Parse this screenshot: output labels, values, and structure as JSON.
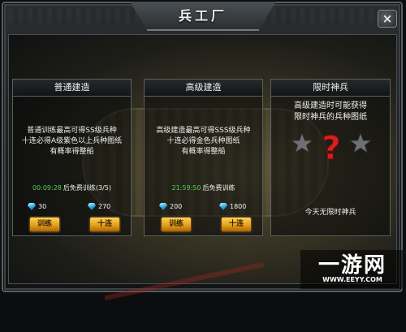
{
  "window": {
    "title": "兵工厂",
    "close_label": "×"
  },
  "panels": [
    {
      "header": "普通建造",
      "description": [
        "普通训练最高可得SS级兵种",
        "十连必得A级紫色以上兵种图纸",
        "有概率得整船"
      ],
      "timer": "00:09:28",
      "timer_text": "后免费训练(3/5)",
      "cost_single": "30",
      "cost_ten": "270",
      "btn_single": "训练",
      "btn_ten": "十连"
    },
    {
      "header": "高级建造",
      "description": [
        "高级建造最高可得SSS级兵种",
        "十连必得金色兵种图纸",
        "有概率得整船"
      ],
      "timer": "21:59:50",
      "timer_text": "后免费训练",
      "cost_single": "200",
      "cost_ten": "1800",
      "btn_single": "训练",
      "btn_ten": "十连"
    },
    {
      "header": "限时神兵",
      "description": [
        "高级建造时可能获得",
        "限时神兵的兵种图纸"
      ],
      "mystery_symbol": "?",
      "footer": "今天无限时神兵"
    }
  ],
  "watermark": {
    "main": "一游网",
    "sub": "WWW.EEYY.COM"
  },
  "colors": {
    "timer_green": "#4fd44f",
    "button_gold": "#f5b631",
    "question_red": "#d62020"
  }
}
